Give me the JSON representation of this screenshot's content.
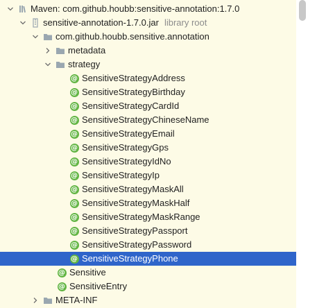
{
  "tree": {
    "maven_root": {
      "label": "Maven: com.github.houbb:sensitive-annotation:1.7.0",
      "icon": "library-icon"
    },
    "jar": {
      "label": "sensitive-annotation-1.7.0.jar",
      "sublabel": "library root",
      "icon": "jar-icon"
    },
    "package": {
      "label": "com.github.houbb.sensitive.annotation",
      "icon": "folder-icon"
    },
    "metadata": {
      "label": "metadata",
      "icon": "folder-icon"
    },
    "strategy": {
      "label": "strategy",
      "icon": "folder-icon"
    },
    "strategy_items": [
      "SensitiveStrategyAddress",
      "SensitiveStrategyBirthday",
      "SensitiveStrategyCardId",
      "SensitiveStrategyChineseName",
      "SensitiveStrategyEmail",
      "SensitiveStrategyGps",
      "SensitiveStrategyIdNo",
      "SensitiveStrategyIp",
      "SensitiveStrategyMaskAll",
      "SensitiveStrategyMaskHalf",
      "SensitiveStrategyMaskRange",
      "SensitiveStrategyPassport",
      "SensitiveStrategyPassword",
      "SensitiveStrategyPhone"
    ],
    "selected_item": "SensitiveStrategyPhone",
    "package_items": [
      "Sensitive",
      "SensitiveEntry"
    ],
    "meta_inf": {
      "label": "META-INF",
      "icon": "folder-icon"
    },
    "annotation_glyph": "@"
  },
  "colors": {
    "background": "#fdfbe6",
    "selection": "#2f65ca",
    "annotation_icon": "#62b543",
    "folder": "#9aa7b0"
  }
}
